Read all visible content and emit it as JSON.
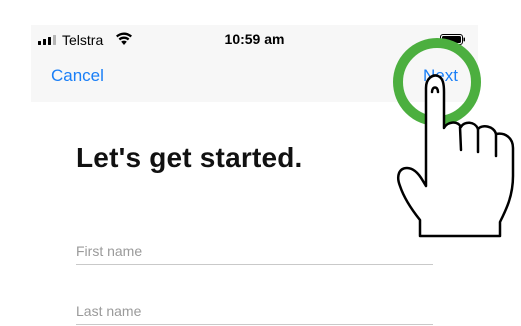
{
  "status_bar": {
    "carrier": "Telstra",
    "time": "10:59 am"
  },
  "nav": {
    "cancel_label": "Cancel",
    "next_label": "Next"
  },
  "title": "Let's get started.",
  "form": {
    "first_name_placeholder": "First name",
    "first_name_value": "",
    "last_name_placeholder": "Last name",
    "last_name_value": ""
  },
  "colors": {
    "accent": "#1a7ff7",
    "tap_indicator": "#4caf3f",
    "bar_background": "#f7f7f7"
  },
  "icons": [
    "signal-icon",
    "wifi-icon",
    "battery-icon",
    "tap-hand-icon"
  ]
}
